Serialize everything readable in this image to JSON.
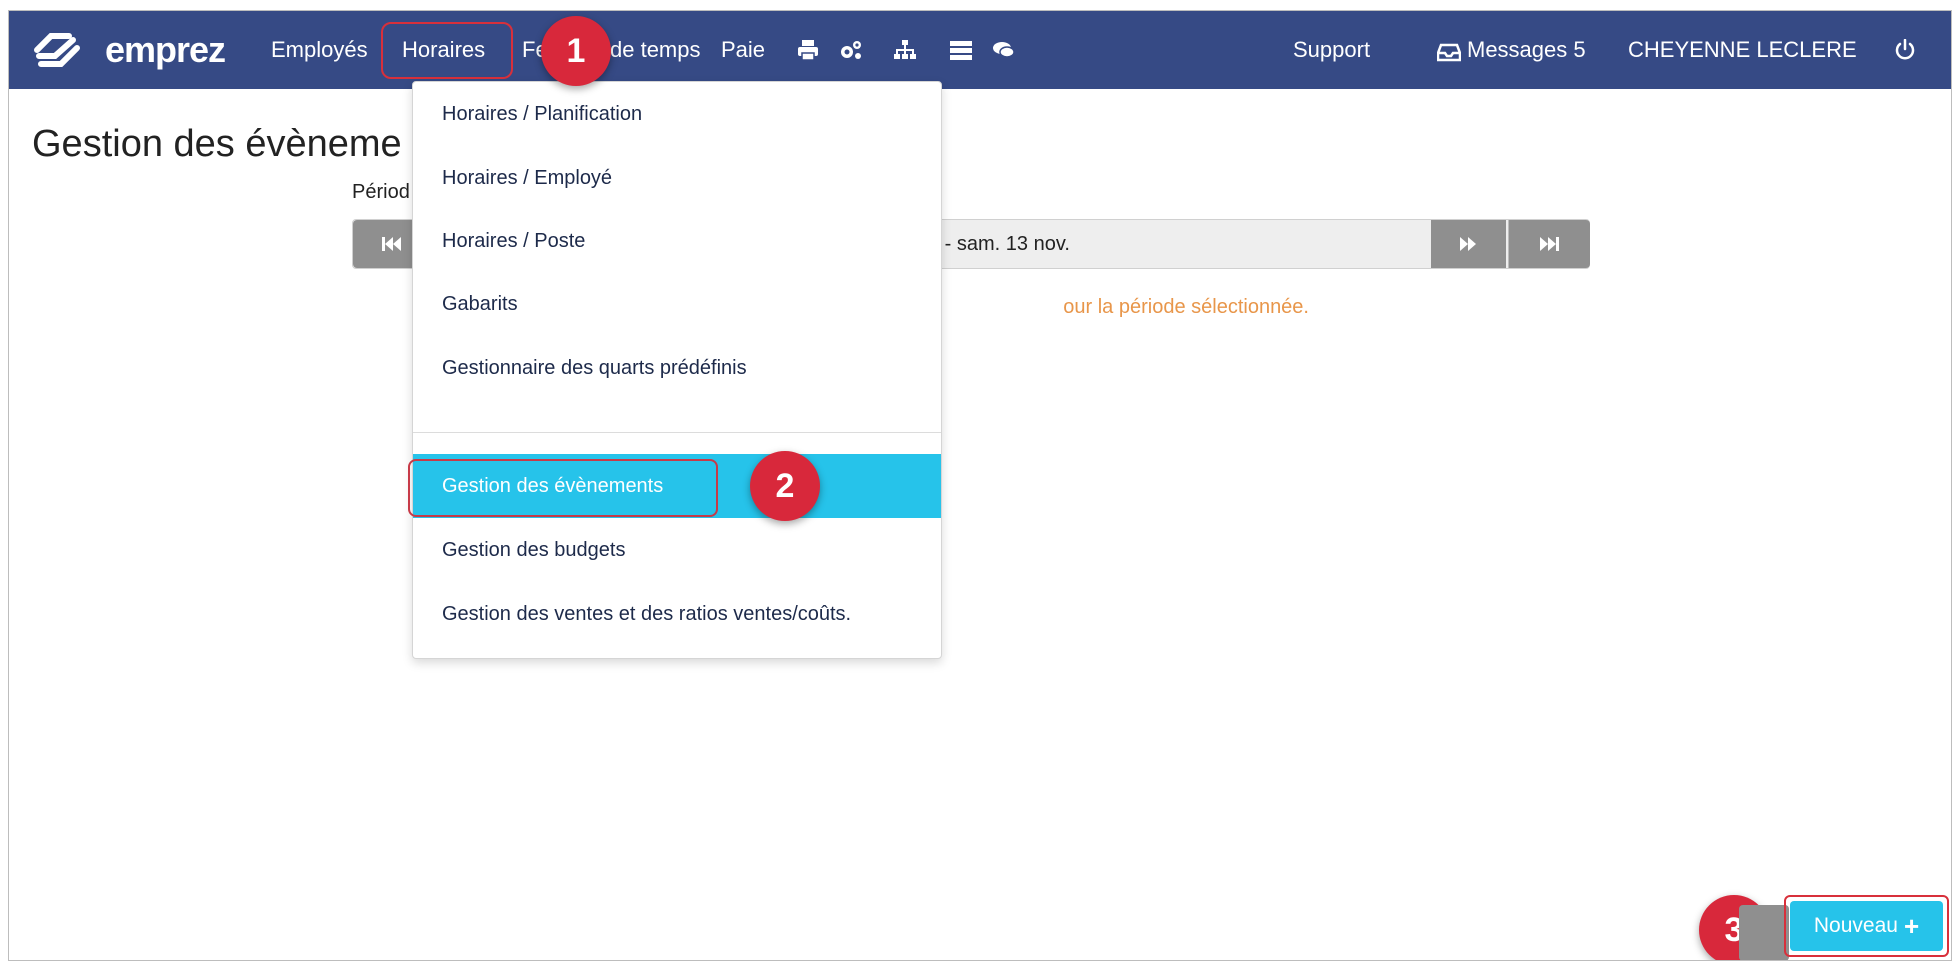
{
  "brand": {
    "name": "emprez"
  },
  "nav": {
    "employes": "Employés",
    "horaires": "Horaires",
    "feuilles_partial_left": "Fe",
    "feuilles_partial_right": "de temps",
    "paie": "Paie",
    "support": "Support",
    "messages": "Messages 5",
    "user": "CHEYENNE LECLERE",
    "icons": [
      "print-icon",
      "settings-icon",
      "org-chart-icon",
      "server-icon",
      "chat-icon",
      "power-icon"
    ]
  },
  "page": {
    "title": "Gestion des évèneme",
    "period_label": "Périod",
    "period_text": "t. - sam. 13 nov.",
    "warning": "our la période sélectionnée."
  },
  "dropdown": {
    "items": [
      "Horaires / Planification",
      "Horaires / Employé",
      "Horaires / Poste",
      "Gabarits",
      "Gestionnaire des quarts prédéfinis",
      "Gestion des évènements",
      "Gestion des budgets",
      "Gestion des ventes et des ratios ventes/coûts."
    ],
    "active_index": 5
  },
  "badges": {
    "one": "1",
    "two": "2",
    "three": "3"
  },
  "actions": {
    "new_button": "Nouveau",
    "new_plus": "+"
  },
  "colors": {
    "navbar": "#364a85",
    "accent": "#26c3ea",
    "highlight": "#d8303b",
    "warning": "#e8964a"
  }
}
